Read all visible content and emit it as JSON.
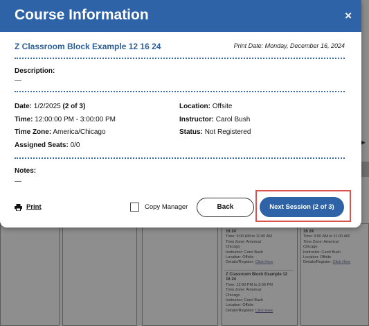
{
  "modal": {
    "title": "Course Information",
    "close_symbol": "×",
    "course_name": "Z Classroom Block Example 12 16 24",
    "print_date": "Print Date: Monday, December 16, 2024",
    "description_label": "Description:",
    "description_value": "—",
    "date_label": "Date:",
    "date_value": "1/2/2025",
    "date_session": "(2 of 3)",
    "time_label": "Time:",
    "time_value": "12:00:00 PM - 3:00:00 PM",
    "timezone_label": "Time Zone:",
    "timezone_value": "America/Chicago",
    "seats_label": "Assigned Seats:",
    "seats_value": "0/0",
    "location_label": "Location:",
    "location_value": "Offsite",
    "instructor_label": "Instructor:",
    "instructor_value": "Carol Bush",
    "status_label": "Status:",
    "status_value": "Not Registered",
    "notes_label": "Notes:",
    "notes_value": "—",
    "print_label": "Print",
    "copy_manager_label": "Copy Manager",
    "back_label": "Back",
    "next_label": "Next Session (2 of 3)",
    "colors": {
      "header": "#2e63a7",
      "accent_text": "#2b5f99",
      "highlight": "#d9534f"
    }
  },
  "background": {
    "event1": {
      "title_tail": "16 24",
      "time": "Time: 9:00 AM to 11:00 AM",
      "tz": "Time Zone: America/",
      "tz2": "Chicago",
      "instructor": "Instructor: Carol Bush",
      "location": "Location: Offsite",
      "details": "Details/Register:",
      "link": "Click Here"
    },
    "event2": {
      "title": "Z Classroom Block Example 12",
      "title2": "16 24",
      "time": "Time: 12:00 PM to 3:00 PM",
      "tz": "Time Zone: America/",
      "tz2": "Chicago",
      "instructor": "Instructor: Carol Bush",
      "location": "Location: Offsite",
      "details": "Details/Register:",
      "link": "Click Here"
    },
    "event3": {
      "title_tail": "16 24",
      "time": "Time: 9:00 AM to 11:00 AM",
      "tz": "Time Zone: America/",
      "tz2": "Chicago",
      "instructor": "Instructor: Carol Bush",
      "location": "Location: Offsite",
      "details": "Details/Register:",
      "link": "Click Here"
    }
  }
}
